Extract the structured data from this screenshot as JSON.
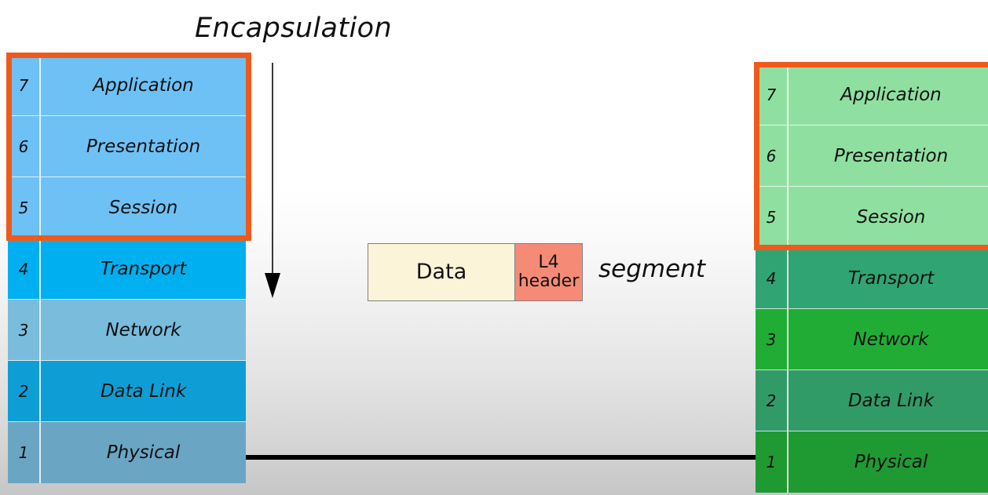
{
  "title": "Encapsulation",
  "left_stack": {
    "name": "sender-osi-stack",
    "layers": [
      {
        "number": "7",
        "label": "Application",
        "color": "#6ec1f5"
      },
      {
        "number": "6",
        "label": "Presentation",
        "color": "#6ec1f5"
      },
      {
        "number": "5",
        "label": "Session",
        "color": "#6ec1f5"
      },
      {
        "number": "4",
        "label": "Transport",
        "color": "#00aff0"
      },
      {
        "number": "3",
        "label": "Network",
        "color": "#79bcdc"
      },
      {
        "number": "2",
        "label": "Data Link",
        "color": "#0e9ed5"
      },
      {
        "number": "1",
        "label": "Physical",
        "color": "#6aa6c4"
      }
    ],
    "highlight_color": "#ef5a1a",
    "highlighted_layers": [
      "7",
      "6",
      "5"
    ]
  },
  "right_stack": {
    "name": "receiver-osi-stack",
    "layers": [
      {
        "number": "7",
        "label": "Application",
        "color": "#8fe0a0"
      },
      {
        "number": "6",
        "label": "Presentation",
        "color": "#8fe0a0"
      },
      {
        "number": "5",
        "label": "Session",
        "color": "#8fe0a0"
      },
      {
        "number": "4",
        "label": "Transport",
        "color": "#30a472"
      },
      {
        "number": "3",
        "label": "Network",
        "color": "#21ad35"
      },
      {
        "number": "2",
        "label": "Data Link",
        "color": "#319b68"
      },
      {
        "number": "1",
        "label": "Physical",
        "color": "#1f9a33"
      }
    ],
    "highlight_color": "#ef5a1a",
    "highlighted_layers": [
      "7",
      "6",
      "5"
    ]
  },
  "pdu": {
    "data_label": "Data",
    "header_line1": "L4",
    "header_line2": "header",
    "pdu_name": "segment",
    "data_color": "#fbf4d8",
    "header_color": "#f58b77"
  },
  "arrow": {
    "name": "encapsulation-down-arrow",
    "direction": "down",
    "color": "#3a3a3a"
  },
  "medium": {
    "name": "physical-medium-line",
    "color": "#000000"
  }
}
